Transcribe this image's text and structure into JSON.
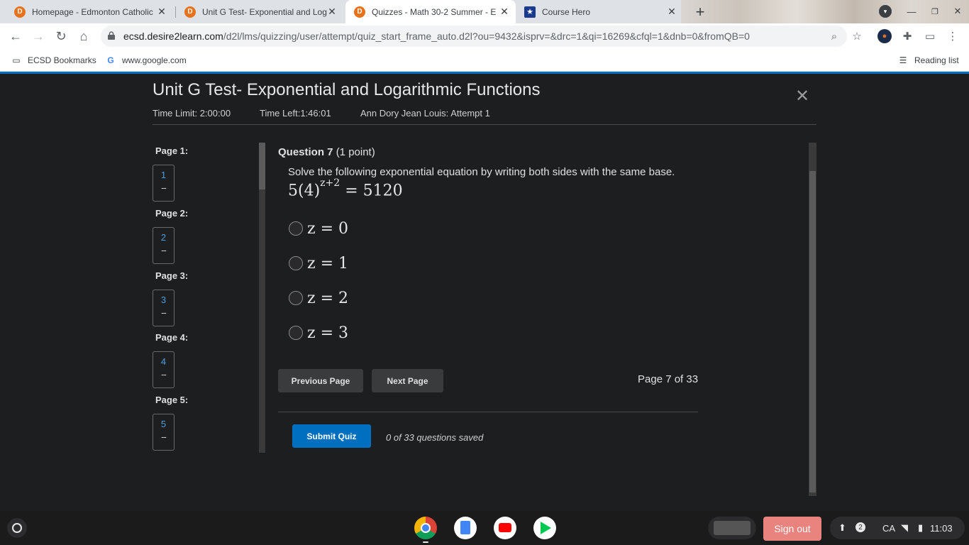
{
  "browser": {
    "tabs": [
      {
        "title": "Homepage - Edmonton Catholic",
        "favicon": "d2l-icon"
      },
      {
        "title": "Unit G Test- Exponential and Log",
        "favicon": "d2l-icon"
      },
      {
        "title": "Quizzes - Math 30-2 Summer - E",
        "favicon": "d2l-icon"
      },
      {
        "title": "Course Hero",
        "favicon": "coursehero-icon"
      }
    ],
    "active_tab_index": 2,
    "url_host": "ecsd.desire2learn.com",
    "url_path": "/d2l/lms/quizzing/user/attempt/quiz_start_frame_auto.d2l?ou=9432&isprv=&drc=1&qi=16269&cfql=1&dnb=0&fromQB=0",
    "bookmarks": [
      {
        "label": "ECSD Bookmarks",
        "icon": "folder-icon"
      },
      {
        "label": "www.google.com",
        "icon": "google-icon"
      }
    ],
    "reading_list": "Reading list"
  },
  "quiz": {
    "title": "Unit G Test- Exponential and Logarithmic Functions",
    "time_limit": "Time Limit: 2:00:00",
    "time_left": "Time Left:1:46:01",
    "attempt": "Ann Dory Jean Louis: Attempt 1",
    "pages": [
      {
        "label": "Page 1:",
        "num": "1",
        "status": "--"
      },
      {
        "label": "Page 2:",
        "num": "2",
        "status": "--"
      },
      {
        "label": "Page 3:",
        "num": "3",
        "status": "--"
      },
      {
        "label": "Page 4:",
        "num": "4",
        "status": "--"
      },
      {
        "label": "Page 5:",
        "num": "5",
        "status": "--"
      }
    ],
    "question": {
      "header": "Question 7",
      "points": "(1 point)",
      "text": "Solve the following exponential equation by writing both sides with the same base.",
      "equation_base": "5(4)",
      "equation_exp": "z+2",
      "equation_rhs": "= 5120",
      "options": [
        "z = 0",
        "z = 1",
        "z = 2",
        "z = 3"
      ]
    },
    "prev_label": "Previous Page",
    "next_label": "Next Page",
    "page_status": "Page 7 of 33",
    "submit_label": "Submit Quiz",
    "saved_status": "0 of 33 questions saved"
  },
  "shelf": {
    "signout_label": "Sign out",
    "notification_count": "2",
    "locale": "CA",
    "time": "11:03"
  },
  "colors": {
    "accent": "#006fbf",
    "link": "#4a9fe0",
    "signout": "#e8837d",
    "favicon": "#e8711a"
  }
}
